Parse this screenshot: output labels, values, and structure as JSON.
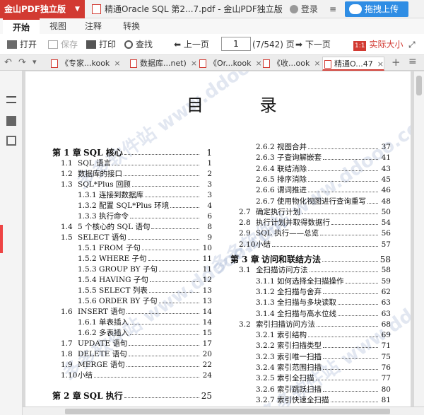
{
  "titlebar": {
    "app_name": "金山PDF独立版",
    "window_title": "精通Oracle SQL  第2...7.pdf - 金山PDF独立版",
    "login": "登录",
    "upload": "拖拽上传"
  },
  "ribbon_tabs": [
    "开始",
    "视图",
    "注释",
    "转换"
  ],
  "toolbar": {
    "open": "打开",
    "save": "保存",
    "print": "打印",
    "find": "查找",
    "prev": "上一页",
    "page_value": "1",
    "page_count": "(7/542) 页",
    "next": "下一页",
    "actual_size": "实际大小",
    "actual_icon": "1:1"
  },
  "doc_tabs": [
    {
      "label": "《专家...kook"
    },
    {
      "label": "数据库...net)"
    },
    {
      "label": "《Or...kook"
    },
    {
      "label": "《收...ook"
    },
    {
      "label": "精通O...47"
    }
  ],
  "toc": {
    "title": "目 录",
    "left": [
      {
        "num": "第 1 章",
        "text": "SQL 核心",
        "page": "1",
        "level": 0
      },
      {
        "num": "1.1",
        "text": "SQL 语言",
        "page": "1",
        "level": 1
      },
      {
        "num": "1.2",
        "text": "数据库的接口",
        "page": "2",
        "level": 1
      },
      {
        "num": "1.3",
        "text": "SQL*Plus 回顾",
        "page": "3",
        "level": 1
      },
      {
        "num": "1.3.1",
        "text": "连接到数据库",
        "page": "3",
        "level": 2
      },
      {
        "num": "1.3.2",
        "text": "配置 SQL*Plus 环境",
        "page": "4",
        "level": 2
      },
      {
        "num": "1.3.3",
        "text": "执行命令",
        "page": "6",
        "level": 2
      },
      {
        "num": "1.4",
        "text": "5 个核心的 SQL 语句",
        "page": "8",
        "level": 1
      },
      {
        "num": "1.5",
        "text": "SELECT 语句",
        "page": "9",
        "level": 1
      },
      {
        "num": "1.5.1",
        "text": "FROM 子句",
        "page": "10",
        "level": 2
      },
      {
        "num": "1.5.2",
        "text": "WHERE 子句",
        "page": "11",
        "level": 2
      },
      {
        "num": "1.5.3",
        "text": "GROUP BY 子句",
        "page": "11",
        "level": 2
      },
      {
        "num": "1.5.4",
        "text": "HAVING 子句",
        "page": "12",
        "level": 2
      },
      {
        "num": "1.5.5",
        "text": "SELECT 列表",
        "page": "13",
        "level": 2
      },
      {
        "num": "1.5.6",
        "text": "ORDER BY 子句",
        "page": "13",
        "level": 2
      },
      {
        "num": "1.6",
        "text": "INSERT 语句",
        "page": "14",
        "level": 1
      },
      {
        "num": "1.6.1",
        "text": "单表插入",
        "page": "14",
        "level": 2
      },
      {
        "num": "1.6.2",
        "text": "多表插入",
        "page": "15",
        "level": 2
      },
      {
        "num": "1.7",
        "text": "UPDATE 语句",
        "page": "17",
        "level": 1
      },
      {
        "num": "1.8",
        "text": "DELETE 语句",
        "page": "20",
        "level": 1
      },
      {
        "num": "1.9",
        "text": "MERGE 语句",
        "page": "22",
        "level": 1
      },
      {
        "num": "1.10",
        "text": "小结",
        "page": "24",
        "level": 1
      },
      {
        "num": "第 2 章",
        "text": "SQL 执行",
        "page": "25",
        "level": 0
      }
    ],
    "right": [
      {
        "num": "2.6.2",
        "text": "视图合并",
        "page": "37",
        "level": 2
      },
      {
        "num": "2.6.3",
        "text": "子查询解嵌套",
        "page": "41",
        "level": 2
      },
      {
        "num": "2.6.4",
        "text": "联结消除",
        "page": "43",
        "level": 2
      },
      {
        "num": "2.6.5",
        "text": "排序消除",
        "page": "45",
        "level": 2
      },
      {
        "num": "2.6.6",
        "text": "谓词推进",
        "page": "46",
        "level": 2
      },
      {
        "num": "2.6.7",
        "text": "使用物化视图进行查询重写",
        "page": "48",
        "level": 2
      },
      {
        "num": "2.7",
        "text": "确定执行计划",
        "page": "50",
        "level": 1
      },
      {
        "num": "2.8",
        "text": "执行计划并取得数据行",
        "page": "54",
        "level": 1
      },
      {
        "num": "2.9",
        "text": "SQL 执行——总览",
        "page": "56",
        "level": 1
      },
      {
        "num": "2.10",
        "text": "小结",
        "page": "57",
        "level": 1
      },
      {
        "num": "第 3 章",
        "text": "访问和联结方法",
        "page": "58",
        "level": 0
      },
      {
        "num": "3.1",
        "text": "全扫描访问方法",
        "page": "58",
        "level": 1
      },
      {
        "num": "3.1.1",
        "text": "如何选择全扫描操作",
        "page": "59",
        "level": 2
      },
      {
        "num": "3.1.2",
        "text": "全扫描与舍弃",
        "page": "62",
        "level": 2
      },
      {
        "num": "3.1.3",
        "text": "全扫描与多块读取",
        "page": "63",
        "level": 2
      },
      {
        "num": "3.1.4",
        "text": "全扫描与高水位线",
        "page": "63",
        "level": 2
      },
      {
        "num": "3.2",
        "text": "索引扫描访问方法",
        "page": "68",
        "level": 1
      },
      {
        "num": "3.2.1",
        "text": "索引结构",
        "page": "69",
        "level": 2
      },
      {
        "num": "3.2.2",
        "text": "索引扫描类型",
        "page": "71",
        "level": 2
      },
      {
        "num": "3.2.3",
        "text": "索引唯一扫描",
        "page": "75",
        "level": 2
      },
      {
        "num": "3.2.4",
        "text": "索引范围扫描",
        "page": "76",
        "level": 2
      },
      {
        "num": "3.2.5",
        "text": "索引全扫描",
        "page": "77",
        "level": 2
      },
      {
        "num": "3.2.6",
        "text": "索引跳跃扫描",
        "page": "80",
        "level": 2
      },
      {
        "num": "3.2.7",
        "text": "索引快速全扫描",
        "page": "81",
        "level": 2
      }
    ]
  },
  "watermark": "多多软件站 www.ddooo.com",
  "colors": {
    "accent": "#d23a32",
    "upload": "#2f8de4"
  }
}
